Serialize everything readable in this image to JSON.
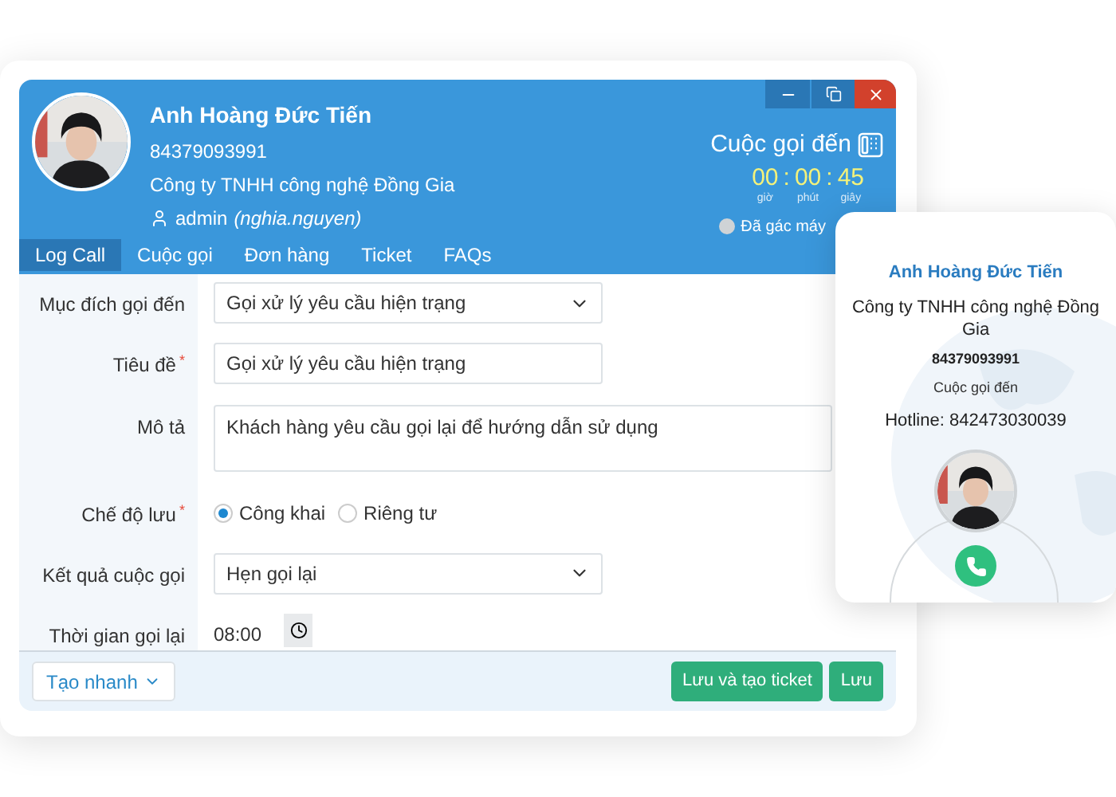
{
  "caller": {
    "name": "Anh Hoàng Đức Tiến",
    "phone": "84379093991",
    "company": "Công ty TNHH công nghệ Đồng Gia",
    "user": "admin",
    "user_alias": "(nghia.nguyen)"
  },
  "call_status": {
    "title": "Cuộc gọi đến",
    "timer": [
      {
        "value": "00",
        "unit": "giờ"
      },
      {
        "value": "00",
        "unit": "phút"
      },
      {
        "value": "45",
        "unit": "giây"
      }
    ],
    "separator": ":",
    "hangup_label": "Đã gác máy",
    "hung_up": false
  },
  "tabs": [
    {
      "label": "Log Call",
      "selected": true
    },
    {
      "label": "Cuộc gọi",
      "selected": false
    },
    {
      "label": "Đơn hàng",
      "selected": false
    },
    {
      "label": "Ticket",
      "selected": false
    },
    {
      "label": "FAQs",
      "selected": false
    }
  ],
  "required_mark": "*",
  "form": [
    {
      "kind": "select",
      "label": "Mục đích gọi đến",
      "required": false,
      "value": "Gọi xử lý yêu cầu hiện trạng"
    },
    {
      "kind": "text",
      "label": "Tiêu đề",
      "required": true,
      "value": "Gọi xử lý yêu cầu hiện trạng"
    },
    {
      "kind": "textarea",
      "label": "Mô tả",
      "required": false,
      "value": "Khách hàng yêu cầu gọi lại để hướng dẫn sử dụng"
    },
    {
      "kind": "radio",
      "label": "Chế độ lưu",
      "required": true,
      "options": [
        {
          "label": "Công khai",
          "selected": true
        },
        {
          "label": "Riêng tư",
          "selected": false
        }
      ]
    },
    {
      "kind": "select",
      "label": "Kết quả cuộc gọi",
      "required": false,
      "value": "Hẹn gọi lại"
    },
    {
      "kind": "time",
      "label": "Thời gian gọi lại",
      "required": false,
      "value": "08:00"
    }
  ],
  "footer": {
    "quick_create": "Tạo nhanh",
    "buttons": [
      "Lưu và tạo ticket",
      "Lưu"
    ]
  },
  "popup": {
    "name": "Anh Hoàng Đức Tiến",
    "company": "Công ty TNHH công nghệ Đồng Gia",
    "phone": "84379093991",
    "status": "Cuộc gọi đến",
    "hotline": "Hotline: 842473030039"
  }
}
